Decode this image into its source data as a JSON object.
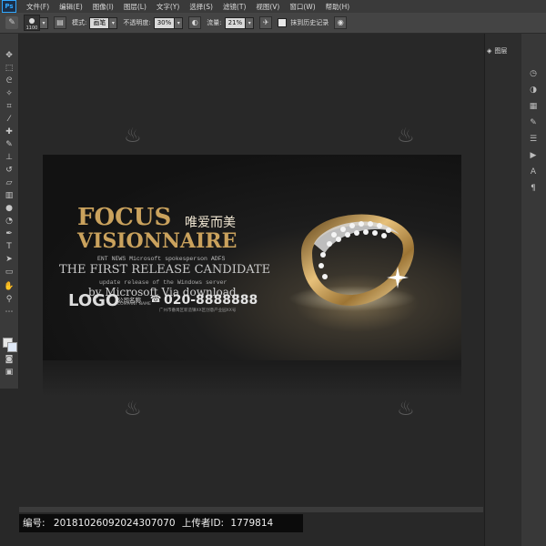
{
  "menu": {
    "logo": "Ps",
    "items": [
      "文件(F)",
      "编辑(E)",
      "图像(I)",
      "图层(L)",
      "文字(Y)",
      "选择(S)",
      "滤镜(T)",
      "视图(V)",
      "窗口(W)",
      "帮助(H)"
    ]
  },
  "options": {
    "brush_size": "1100",
    "mode_label": "模式:",
    "mode_value": "画笔",
    "opacity_label": "不透明度:",
    "opacity_value": "30%",
    "flow_label": "流量:",
    "flow_value": "21%",
    "history_label": "抹到历史记录"
  },
  "panels": {
    "layers_tab": "图层"
  },
  "banner": {
    "focus": "FOCUS",
    "cn_tagline": "唯爱而美",
    "visionnaire": "VISIONNAIRE",
    "small_line1": "ENT NEWS Microsoft spokesperson ADFS",
    "headline": "THE FIRST RELEASE CANDIDATE",
    "small_line2": "update release of the Windows server",
    "by_line": "by Microsoft Via download.",
    "logo": "LOGO",
    "company_name": "公司名称",
    "company_name_en": "COMPANY NAME",
    "phone": "020-8888888",
    "address": "广州市番禺区新造镇XX区创意产业园XX号"
  },
  "watermark_glyph": "♨",
  "caption": {
    "id_label": "编号:",
    "id_value": "20181026092024307070",
    "uploader_label": "上传者ID:",
    "uploader_value": "1779814"
  },
  "colors": {
    "gold": "#caa25d",
    "ps_blue": "#31a8ff"
  }
}
